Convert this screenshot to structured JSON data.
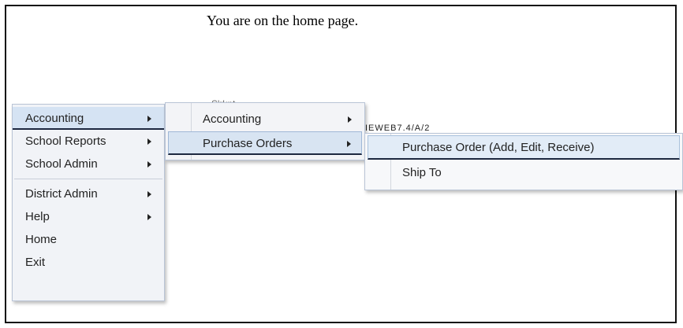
{
  "page": {
    "message": "You are on the home page.",
    "fragment_1": "S'rknt... ",
    "fragment_2": "IEWEB7.4/A/2"
  },
  "main_menu": {
    "items": [
      {
        "label": "Accounting",
        "submenu": true
      },
      {
        "label": "School Reports",
        "submenu": true
      },
      {
        "label": "School Admin",
        "submenu": true
      },
      {
        "label": "District Admin",
        "submenu": true
      },
      {
        "label": "Help",
        "submenu": true
      },
      {
        "label": "Home",
        "submenu": false
      },
      {
        "label": "Exit",
        "submenu": false
      }
    ]
  },
  "accounting_menu": {
    "items": [
      {
        "label": "Accounting"
      },
      {
        "label": "Purchase Orders"
      }
    ]
  },
  "purchase_orders_menu": {
    "items": [
      {
        "label": "Purchase Order (Add, Edit, Receive)"
      },
      {
        "label": "Ship To"
      }
    ]
  }
}
